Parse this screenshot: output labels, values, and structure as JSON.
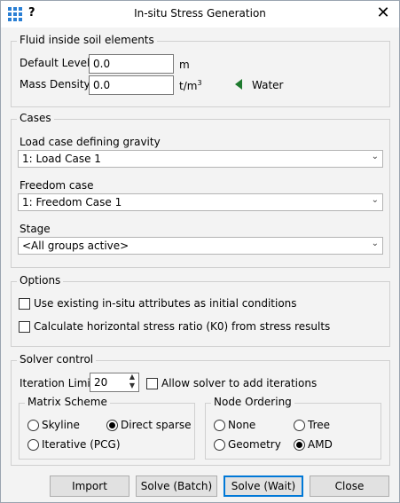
{
  "window": {
    "title": "In-situ Stress Generation",
    "help": "?",
    "close": "✕"
  },
  "fluid": {
    "legend": "Fluid inside soil elements",
    "default_level_label": "Default Level",
    "default_level_value": "0.0",
    "default_level_unit": "m",
    "mass_density_label": "Mass Density",
    "mass_density_value": "0.0",
    "mass_density_unit": "t/m",
    "mass_density_unit_exp": "3",
    "material_label": "Water",
    "material_color": "#1e7a2e"
  },
  "cases": {
    "legend": "Cases",
    "gravity_label": "Load case defining gravity",
    "gravity_value": "1: Load Case 1",
    "freedom_label": "Freedom case",
    "freedom_value": "1: Freedom Case 1",
    "stage_label": "Stage",
    "stage_value": "<All groups active>"
  },
  "options": {
    "legend": "Options",
    "use_existing_label": "Use existing in-situ attributes as initial conditions",
    "use_existing_checked": false,
    "calc_k0_label": "Calculate horizontal stress ratio (K0) from stress results",
    "calc_k0_checked": false
  },
  "solver": {
    "legend": "Solver control",
    "iteration_limit_label": "Iteration Limit",
    "iteration_limit_value": "20",
    "allow_add_label": "Allow solver to add iterations",
    "allow_add_checked": false,
    "matrix": {
      "legend": "Matrix Scheme",
      "skyline": "Skyline",
      "direct_sparse": "Direct sparse",
      "iterative": "Iterative (PCG)",
      "selected": "Direct sparse"
    },
    "ordering": {
      "legend": "Node Ordering",
      "none": "None",
      "tree": "Tree",
      "geometry": "Geometry",
      "amd": "AMD",
      "selected": "AMD"
    }
  },
  "buttons": {
    "import": "Import",
    "solve_batch": "Solve (Batch)",
    "solve_wait": "Solve (Wait)",
    "close": "Close"
  },
  "icons": {
    "app": "grid-app-icon",
    "material": "triangle-left-icon",
    "spin_up": "▲",
    "spin_down": "▼",
    "chevron": "⌄"
  }
}
